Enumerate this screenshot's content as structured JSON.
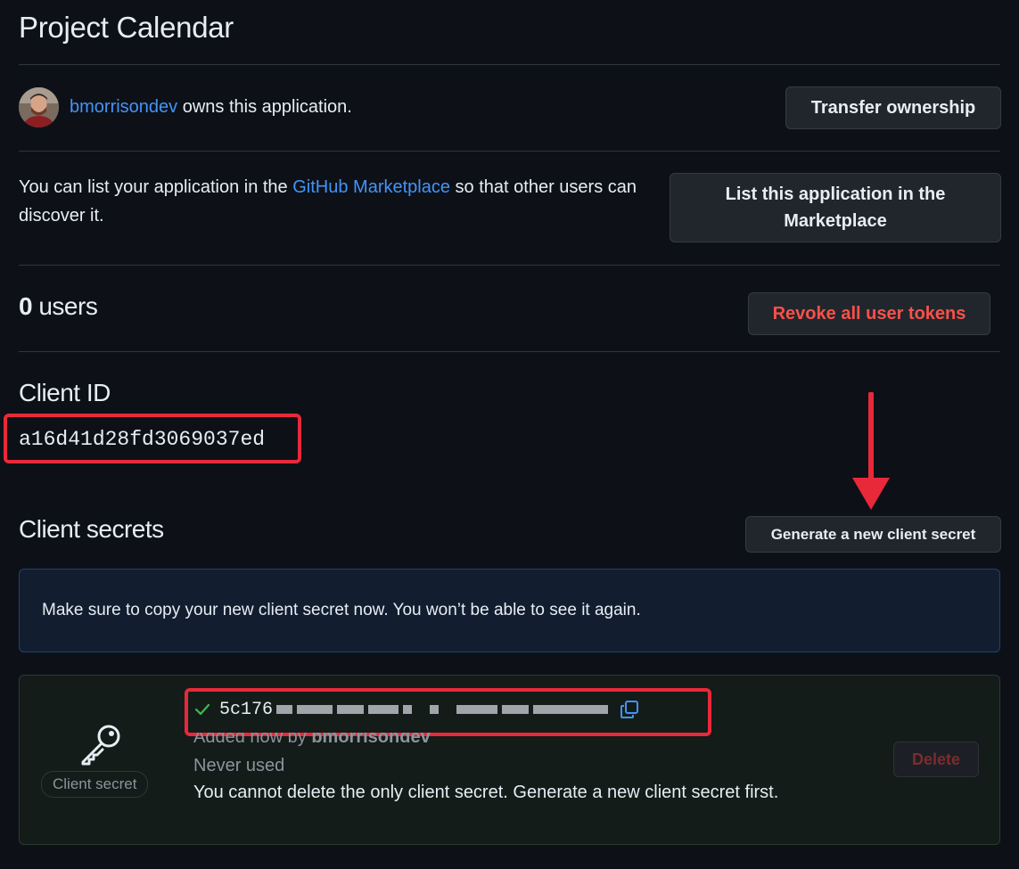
{
  "page": {
    "title": "Project Calendar"
  },
  "owner": {
    "username": "bmorrisondev",
    "suffix": " owns this application.",
    "transfer_button": "Transfer ownership"
  },
  "marketplace": {
    "text_before": "You can list your application in the ",
    "link_text": "GitHub Marketplace",
    "text_after": " so that other users can discover it.",
    "button": "List this application in the Marketplace"
  },
  "users": {
    "count": "0",
    "label": " users",
    "revoke_button": "Revoke all user tokens"
  },
  "client_id": {
    "heading": "Client ID",
    "value": "a16d41d28fd3069037ed"
  },
  "client_secrets": {
    "heading": "Client secrets",
    "generate_button": "Generate a new client secret",
    "flash_message": "Make sure to copy your new client secret now. You won’t be able to see it again.",
    "secret": {
      "badge": "Client secret",
      "value_prefix": "5c176",
      "added_prefix": "Added now by ",
      "added_by": "bmorrisondev",
      "usage": "Never used",
      "note": "You cannot delete the only client secret. Generate a new client secret first.",
      "delete_button": "Delete"
    }
  },
  "colors": {
    "background": "#0d1117",
    "link": "#4493f8",
    "danger": "#f85149",
    "annotation": "#e8293a",
    "success": "#3fb950"
  },
  "icons": {
    "key": "key-icon",
    "check": "check-icon",
    "copy": "copy-icon",
    "arrow": "arrow-down-annotation"
  }
}
